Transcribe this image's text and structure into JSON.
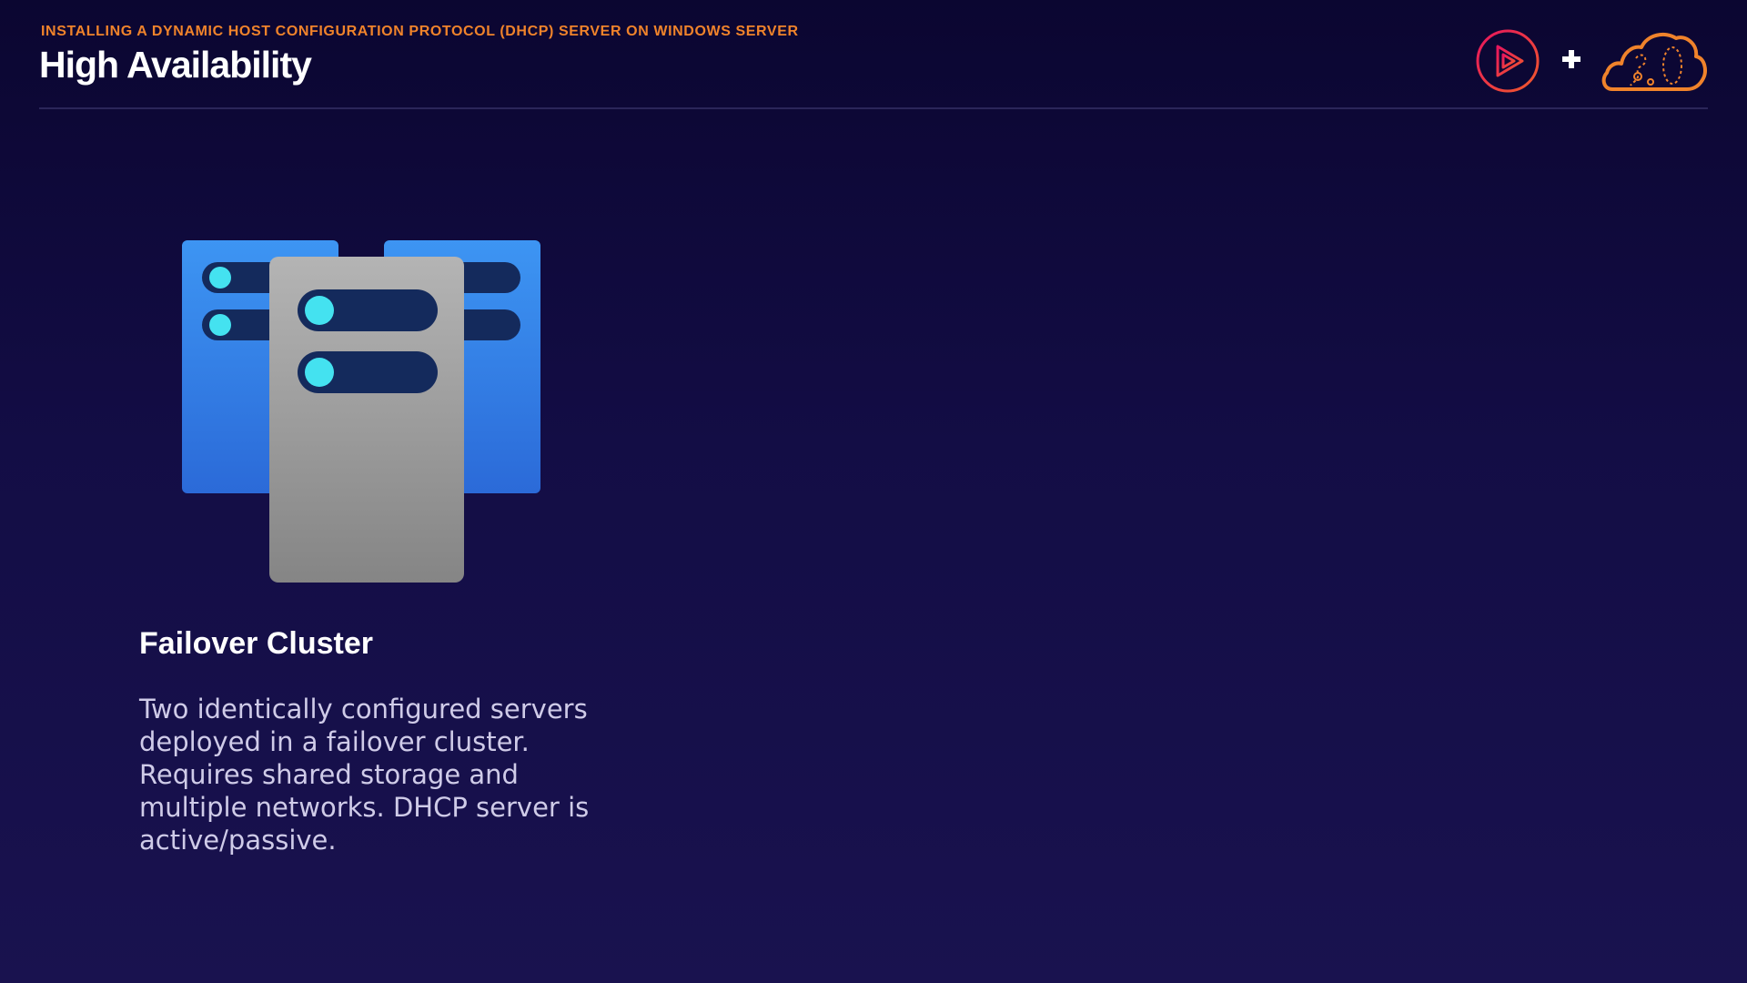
{
  "header": {
    "eyebrow": "INSTALLING A DYNAMIC HOST CONFIGURATION PROTOCOL (DHCP) SERVER ON WINDOWS SERVER",
    "title": "High Availability",
    "plus": "+"
  },
  "logos": {
    "left_icon": "pluralsight-play-icon",
    "right_icon": "cloud-icon"
  },
  "illustration": {
    "icon": "server-cluster-icon"
  },
  "card": {
    "title": "Failover Cluster",
    "description": "Two identically configured servers deployed in a failover cluster. Requires shared storage and multiple networks. DHCP server is active/passive."
  },
  "colors": {
    "accent_orange": "#f0832b",
    "accent_pink": "#e0245e",
    "server_blue": "#2f7fe8",
    "server_grey": "#9a9a9a",
    "indicator_cyan": "#44e2f0"
  }
}
